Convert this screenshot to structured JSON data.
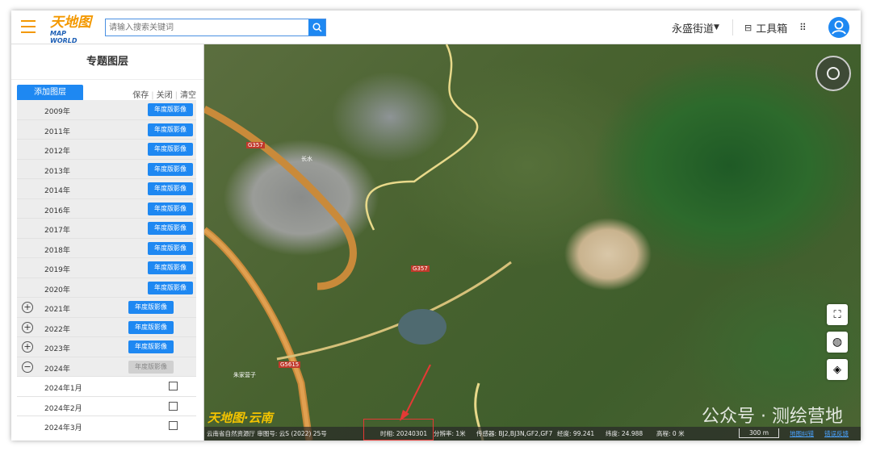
{
  "header": {
    "logo_cn": "天地图",
    "logo_en": "MAP WORLD",
    "search_placeholder": "请输入搜索关键词",
    "region": "永盛街道",
    "toolbox": "工具箱"
  },
  "sidebar": {
    "title": "专题图层",
    "add_layer": "添加图层",
    "actions": [
      "保存",
      "关闭",
      "清空"
    ],
    "years": [
      {
        "label": "2009年",
        "button": "年度版影像"
      },
      {
        "label": "2011年",
        "button": "年度版影像"
      },
      {
        "label": "2012年",
        "button": "年度版影像"
      },
      {
        "label": "2013年",
        "button": "年度版影像"
      },
      {
        "label": "2014年",
        "button": "年度版影像"
      },
      {
        "label": "2016年",
        "button": "年度版影像"
      },
      {
        "label": "2017年",
        "button": "年度版影像"
      },
      {
        "label": "2018年",
        "button": "年度版影像"
      },
      {
        "label": "2019年",
        "button": "年度版影像"
      },
      {
        "label": "2020年",
        "button": "年度版影像"
      }
    ],
    "expandable": [
      {
        "label": "2021年",
        "button": "年度版影像",
        "expanded": false
      },
      {
        "label": "2022年",
        "button": "年度版影像",
        "expanded": false
      },
      {
        "label": "2023年",
        "button": "年度版影像",
        "expanded": false
      },
      {
        "label": "2024年",
        "button": "年度版影像",
        "expanded": true
      }
    ],
    "months": [
      {
        "label": "2024年1月",
        "checked": false
      },
      {
        "label": "2024年2月",
        "checked": false
      },
      {
        "label": "2024年3月",
        "checked": false
      }
    ]
  },
  "map": {
    "labels": [
      "G357",
      "G357",
      "G5615",
      "朱家营子",
      "长水"
    ],
    "logo": "天地图·云南",
    "status": {
      "credit": "云南省自然资源厅 审图号: 云S (2022) 25号",
      "time": "时相: 20240301",
      "resolution": "分辨率: 1米",
      "sensor": "传感器: BJ2,BJ3N,GF2,GF7",
      "lon": "经度: 99.241",
      "lat": "纬度: 24.988",
      "elev": "高程: 0 米",
      "scale": "300 m",
      "link1": "地图纠错",
      "link2": "错误反馈"
    },
    "watermark": "公众号 · 测绘营地"
  },
  "colors": {
    "accent": "#1e88f2",
    "logo": "#f39800",
    "highlight": "#e53935"
  }
}
